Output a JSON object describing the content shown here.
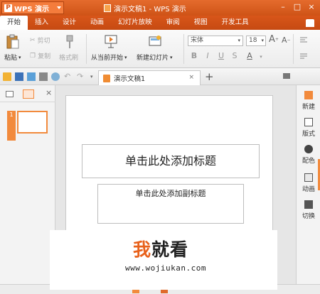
{
  "app": {
    "name": "WPS 演示",
    "logo_letter": "P"
  },
  "window": {
    "title": "演示文稿1 - WPS 演示",
    "minimize": "–",
    "maximize": "□",
    "close": "×"
  },
  "menu": [
    "开始",
    "插入",
    "设计",
    "动画",
    "幻灯片放映",
    "审阅",
    "视图",
    "开发工具"
  ],
  "ribbon": {
    "paste": "粘贴",
    "cut": "剪切",
    "copy": "复制",
    "format_painter": "格式刷",
    "from_current": "从当前开始",
    "new_slide": "新建幻灯片",
    "font_name": "宋体",
    "font_size": "18",
    "bold": "B",
    "italic": "I",
    "underline": "U",
    "strike": "S",
    "font_color": "A",
    "grow": "A",
    "shrink": "A"
  },
  "tab": {
    "doc_name": "演示文稿1",
    "add": "+"
  },
  "left_panel": {
    "slide_number": "1"
  },
  "slide": {
    "title_placeholder": "单击此处添加标题",
    "subtitle_placeholder": "单击此处添加副标题"
  },
  "right_panel": [
    "新建",
    "版式",
    "配色",
    "动画",
    "切换"
  ],
  "watermark": {
    "title_first": "我",
    "title_rest": "就看",
    "url": "www.wojiukan.com"
  },
  "colors": {
    "brand_orange": "#d9541b",
    "accent": "#f28a3c"
  }
}
